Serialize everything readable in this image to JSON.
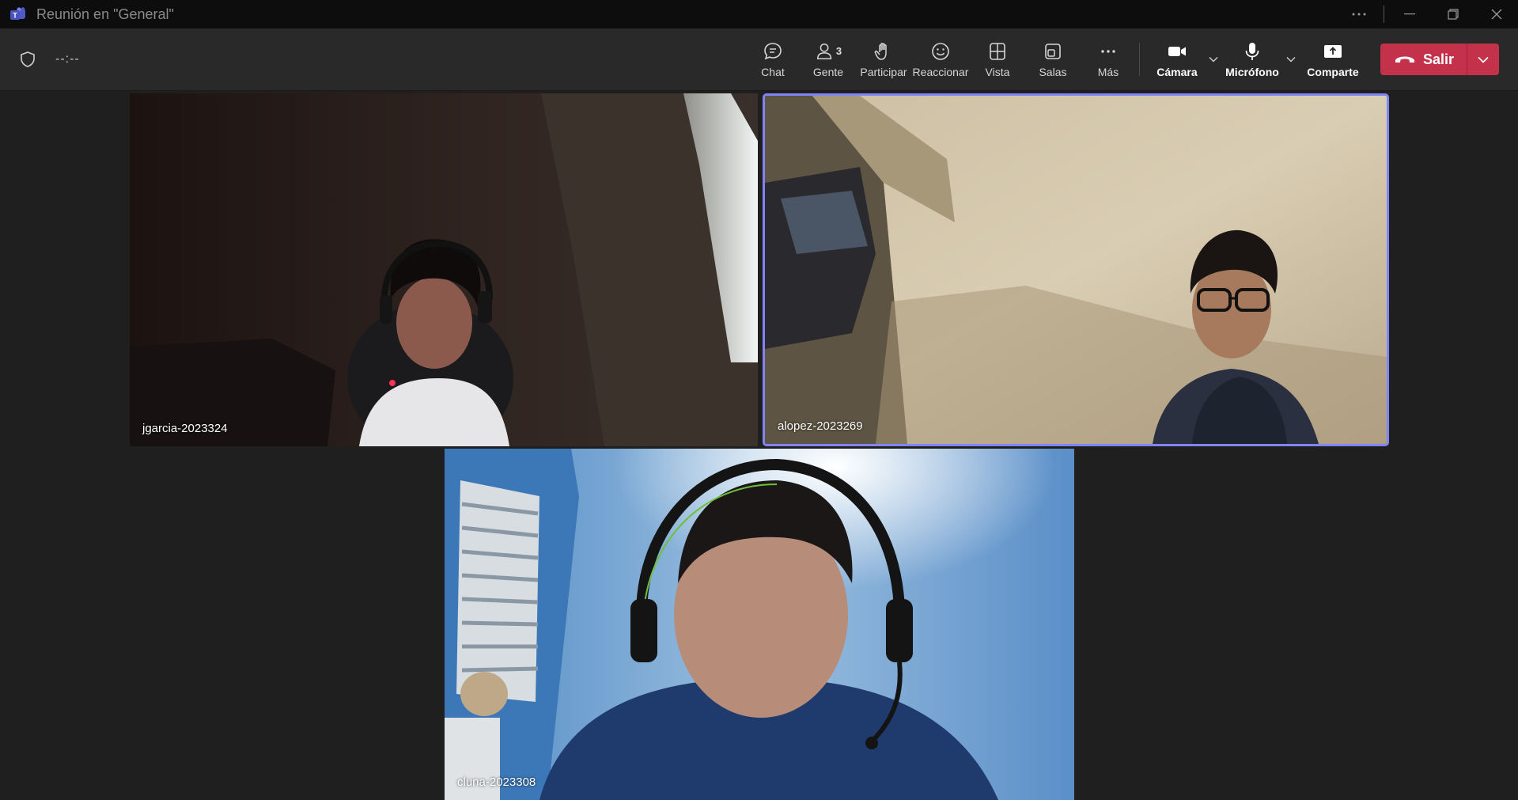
{
  "window": {
    "title": "Reunión en \"General\""
  },
  "toolbar": {
    "timer": "--:--",
    "chat_label": "Chat",
    "people_label": "Gente",
    "people_count": "3",
    "raise_label": "Participar",
    "react_label": "Reaccionar",
    "view_label": "Vista",
    "rooms_label": "Salas",
    "more_label": "Más",
    "camera_label": "Cámara",
    "mic_label": "Micrófono",
    "share_label": "Comparte",
    "leave_label": "Salir"
  },
  "participants": [
    {
      "name": "jgarcia-2023324",
      "speaking": false
    },
    {
      "name": "alopez-2023269",
      "speaking": true
    },
    {
      "name": "cluna-2023308",
      "speaking": false
    }
  ],
  "colors": {
    "accent": "#7f85f5",
    "leave": "#c4314b",
    "background": "#1f1f1f",
    "toolbar": "#292929"
  }
}
